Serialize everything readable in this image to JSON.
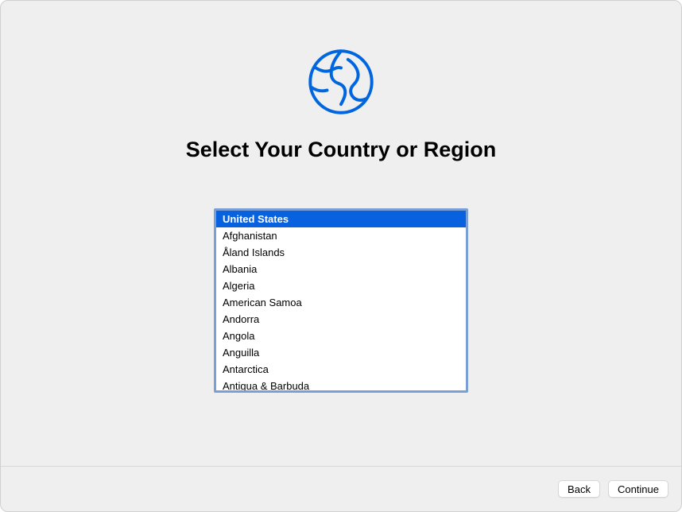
{
  "icon": "globe-icon",
  "title": "Select Your Country or Region",
  "countries": {
    "selected_index": 0,
    "items": [
      "United States",
      "Afghanistan",
      "Åland Islands",
      "Albania",
      "Algeria",
      "American Samoa",
      "Andorra",
      "Angola",
      "Anguilla",
      "Antarctica",
      "Antigua & Barbuda"
    ]
  },
  "buttons": {
    "back": "Back",
    "continue": "Continue"
  },
  "colors": {
    "accent": "#0862e0",
    "focus_ring": "#7a9fd6",
    "background": "#efefef"
  }
}
